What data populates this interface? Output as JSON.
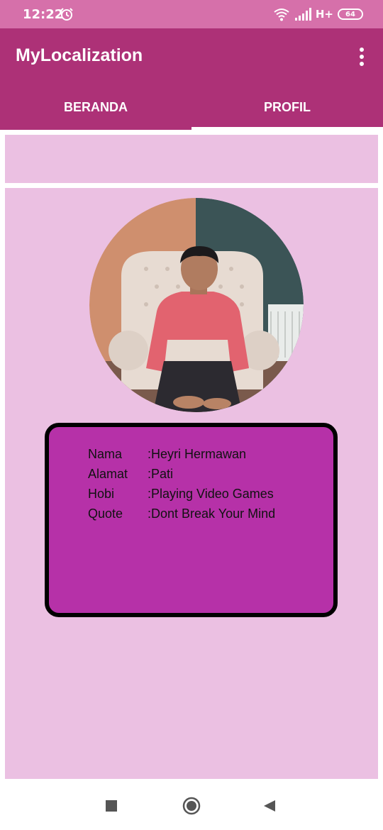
{
  "status_bar": {
    "time": "12:22",
    "network_label": "H+",
    "battery_level": "64"
  },
  "app_bar": {
    "title": "MyLocalization"
  },
  "tabs": [
    {
      "label": "BERANDA",
      "active": false
    },
    {
      "label": "PROFIL",
      "active": true
    }
  ],
  "profile": {
    "rows": [
      {
        "label": "Nama",
        "value": ":Heyri Hermawan"
      },
      {
        "label": "Alamat",
        "value": ":Pati"
      },
      {
        "label": "Hobi",
        "value": ":Playing Video Games"
      },
      {
        "label": "Quote",
        "value": ":Dont Break Your Mind"
      }
    ]
  },
  "colors": {
    "status_bar": "#d670aa",
    "app_bar": "#ad3177",
    "panel": "#ebc0e2",
    "card": "#b631a8"
  },
  "icons": {
    "status": [
      "alarm-icon",
      "wifi-icon",
      "signal-icon",
      "battery-icon"
    ],
    "nav": [
      "recent-apps-icon",
      "home-icon",
      "back-icon"
    ]
  }
}
